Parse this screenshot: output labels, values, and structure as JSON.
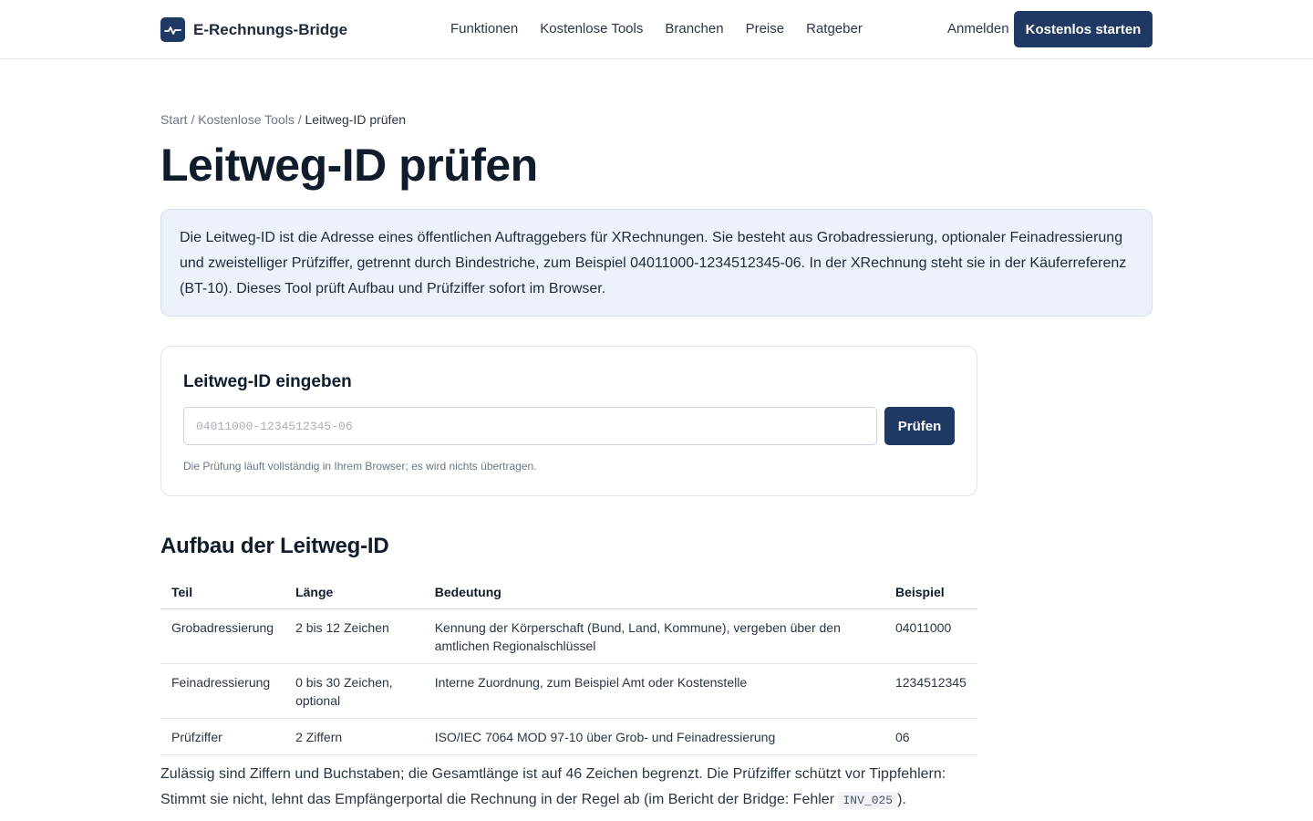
{
  "header": {
    "brand": "E-Rechnungs-Bridge",
    "nav": [
      "Funktionen",
      "Kostenlose Tools",
      "Branchen",
      "Preise",
      "Ratgeber"
    ],
    "login": "Anmelden",
    "cta": "Kostenlos starten"
  },
  "breadcrumb": {
    "items": [
      "Start",
      "Kostenlose Tools"
    ],
    "current": "Leitweg-ID prüfen",
    "separator": "/"
  },
  "page_title": "Leitweg-ID prüfen",
  "info_text": "Die Leitweg-ID ist die Adresse eines öffentlichen Auftraggebers für XRechnungen. Sie besteht aus Grobadressierung, optionaler Feinadressierung und zweistelliger Prüfziffer, getrennt durch Bindestriche, zum Beispiel 04011000-1234512345-06. In der XRechnung steht sie in der Käuferreferenz (BT-10). Dieses Tool prüft Aufbau und Prüfziffer sofort im Browser.",
  "tool": {
    "title": "Leitweg-ID eingeben",
    "input_value": "",
    "placeholder": "04011000-1234512345-06",
    "button": "Prüfen",
    "hint": "Die Prüfung läuft vollständig in Ihrem Browser; es wird nichts übertragen."
  },
  "section": {
    "title": "Aufbau der Leitweg-ID",
    "columns": [
      "Teil",
      "Länge",
      "Bedeutung",
      "Beispiel"
    ],
    "rows": [
      [
        "Grobadressierung",
        "2 bis 12 Zeichen",
        "Kennung der Körperschaft (Bund, Land, Kommune), vergeben über den amtlichen Regionalschlüssel",
        "04011000"
      ],
      [
        "Feinadressierung",
        "0 bis 30 Zeichen, optional",
        "Interne Zuordnung, zum Beispiel Amt oder Kostenstelle",
        "1234512345"
      ],
      [
        "Prüfziffer",
        "2 Ziffern",
        "ISO/IEC 7064 MOD 97-10 über Grob- und Feinadressierung",
        "06"
      ]
    ]
  },
  "note": {
    "text": "Zulässig sind Ziffern und Buchstaben; die Gesamtlänge ist auf 46 Zeichen begrenzt. Die Prüfziffer schützt vor Tippfehlern: Stimmt sie nicht, lehnt das Empfängerportal die Rechnung in der Regel ab (im Bericht der Bridge: Fehler",
    "code": "INV_025",
    "end": ")."
  },
  "colors": {
    "primary": "#1f3864",
    "info_bg": "#edf2fa"
  }
}
